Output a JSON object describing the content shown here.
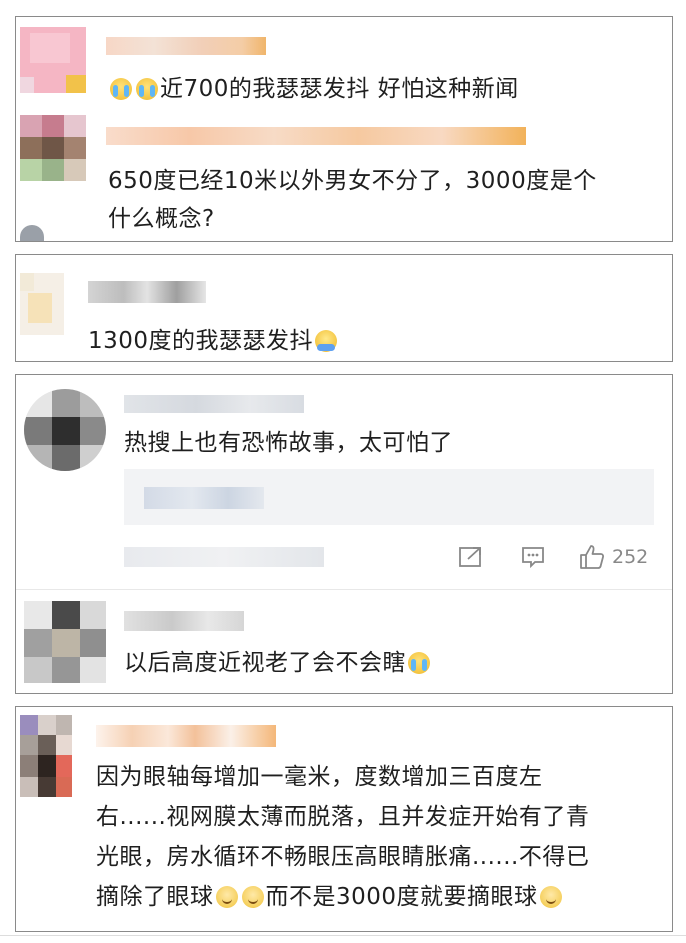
{
  "cards": [
    {
      "comments": [
        {
          "text": "近700的我瑟瑟发抖  好怕这种新闻",
          "emojis": [
            "cry",
            "cry"
          ]
        },
        {
          "text_line1": "650度已经10米以外男女不分了，3000度是个",
          "text_line2": "什么概念?"
        }
      ]
    },
    {
      "comments": [
        {
          "text": "1300度的我瑟瑟发抖",
          "emojis": [
            "sweat"
          ]
        }
      ]
    },
    {
      "comments": [
        {
          "text": "热搜上也有恐怖故事，太可怕了",
          "like_count": "252"
        },
        {
          "text": "以后高度近视老了会不会瞎",
          "emojis": [
            "cry"
          ]
        }
      ]
    },
    {
      "comments": [
        {
          "line1": "因为眼轴每增加一毫米，度数增加三百度左",
          "line2": "右......视网膜太薄而脱落，且并发症开始有了青",
          "line3": "光眼，房水循环不畅眼压高眼睛胀痛......不得已",
          "line4a": "摘除了眼球",
          "line4b": "而不是3000度就要摘眼球",
          "emojis": [
            "think",
            "think",
            "think"
          ]
        }
      ]
    }
  ],
  "colors": {
    "border": "#8a8a8a",
    "icon": "#888888",
    "blur_orange": "#f5c285",
    "blur_gray": "#d9dde3"
  }
}
